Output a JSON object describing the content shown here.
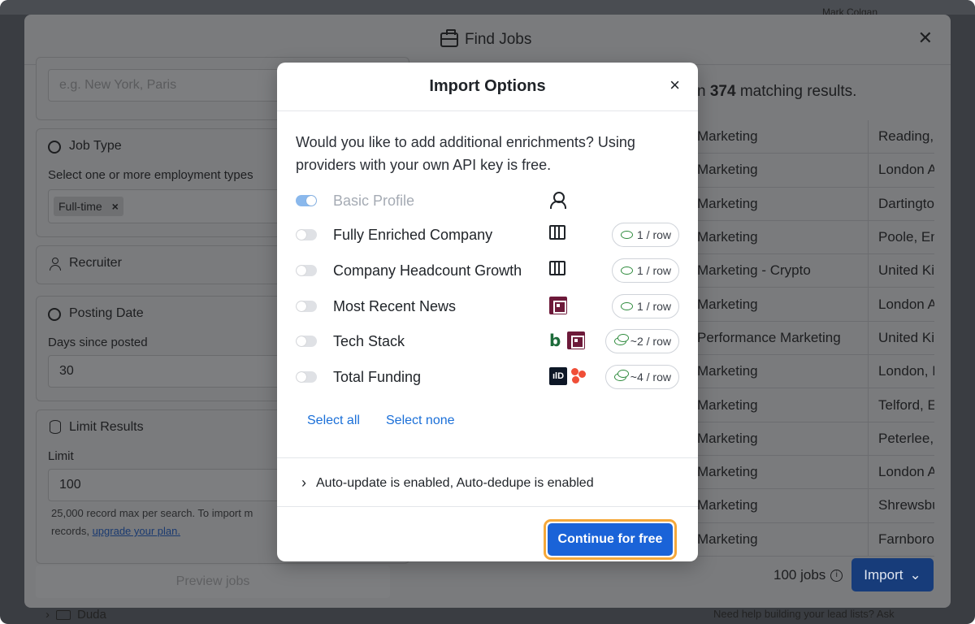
{
  "background": {
    "user_name": "Mark Colgan",
    "folder_name": "Duda",
    "help_text": "Need help building your lead lists? Ask"
  },
  "panel": {
    "title": "Find Jobs",
    "title_icon": "briefcase-icon",
    "location_placeholder": "e.g. New York, Paris",
    "job_type": {
      "title": "Job Type",
      "subtitle": "Select one or more employment types",
      "chip": "Full-time",
      "chip_remove": "×"
    },
    "recruiter": {
      "title": "Recruiter"
    },
    "posting_date": {
      "title": "Posting Date",
      "subtitle": "Days since posted",
      "value": "30"
    },
    "limit_results": {
      "title": "Limit Results",
      "subtitle": "Limit",
      "value": "100",
      "note_line1": "25,000 record max per search. To import m",
      "note_line2": "records, ",
      "note_link": "upgrade your plan."
    },
    "preview_button": "Preview jobs",
    "results_prefix": "n ",
    "results_count": "374",
    "results_suffix": " matching results.",
    "rows": [
      {
        "title": "Marketing",
        "location": "Reading,"
      },
      {
        "title": "Marketing",
        "location": "London A"
      },
      {
        "title": "Marketing",
        "location": "Dartingto"
      },
      {
        "title": "Marketing",
        "location": "Poole, En"
      },
      {
        "title": "Marketing - Crypto",
        "location": "United Ki"
      },
      {
        "title": "Marketing",
        "location": "London A"
      },
      {
        "title": "Performance Marketing",
        "location": "United Ki"
      },
      {
        "title": "Marketing",
        "location": "London, I"
      },
      {
        "title": "Marketing",
        "location": "Telford, E"
      },
      {
        "title": "Marketing",
        "location": "Peterlee,"
      },
      {
        "title": "Marketing",
        "location": "London A"
      },
      {
        "title": "Marketing",
        "location": "Shrewsbu"
      },
      {
        "title": "Marketing",
        "location": "Farnboro"
      }
    ],
    "jobs_count": "100 jobs",
    "import_button": "Import"
  },
  "modal": {
    "title": "Import Options",
    "close": "×",
    "description": "Would you like to add additional enrichments? Using providers with your own API key is free.",
    "options": [
      {
        "label": "Basic Profile",
        "enabled": true,
        "disabled": true,
        "cost": ""
      },
      {
        "label": "Fully Enriched Company",
        "enabled": false,
        "disabled": false,
        "cost": "1 / row"
      },
      {
        "label": "Company Headcount Growth",
        "enabled": false,
        "disabled": false,
        "cost": "1 / row"
      },
      {
        "label": "Most Recent News",
        "enabled": false,
        "disabled": false,
        "cost": "1 / row"
      },
      {
        "label": "Tech Stack",
        "enabled": false,
        "disabled": false,
        "cost": "~2 / row"
      },
      {
        "label": "Total Funding",
        "enabled": false,
        "disabled": false,
        "cost": "~4 / row"
      }
    ],
    "provider_d_text": "ılD",
    "select_all": "Select all",
    "select_none": "Select none",
    "auto_text": "Auto-update is enabled, Auto-dedupe is enabled",
    "continue_button": "Continue for free",
    "colors": {
      "primary": "#1a63d8",
      "focus_ring": "#f5a83a",
      "coin": "#2e8b3d"
    }
  }
}
